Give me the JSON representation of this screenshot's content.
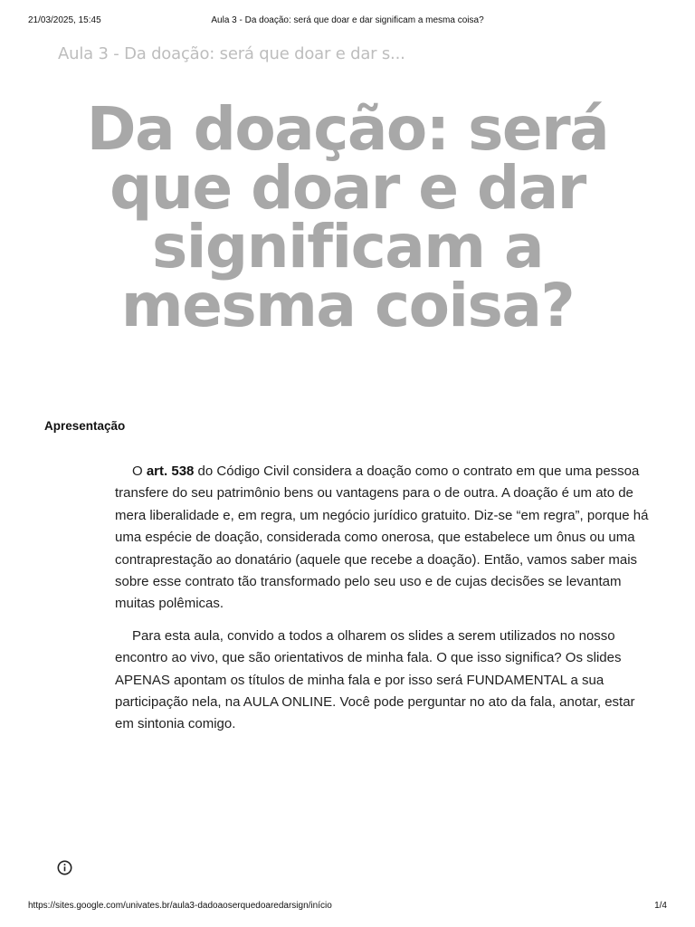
{
  "print_header": {
    "datetime": "21/03/2025, 15:45",
    "document_title": "Aula 3 - Da doação: será que doar e dar significam a mesma coisa?"
  },
  "site": {
    "title": "Aula 3 - Da doação: será que doar e dar s..."
  },
  "hero": {
    "line1": "Da doação: será",
    "line2": "que doar e dar",
    "line3": "significam a",
    "line4": "mesma coisa?"
  },
  "section": {
    "heading": "Apresentação"
  },
  "paragraph1": {
    "prefix": "O ",
    "bold": "art. 538",
    "text": " do Código Civil considera a doação como o contrato em que uma pessoa transfere do seu patrimônio bens ou vantagens para o de outra. A doação é um ato de mera liberalidade e, em regra, um negócio jurídico gratuito. Diz-se “em regra”, porque há uma espécie de doação, considerada como onerosa, que estabelece um ônus ou uma contraprestação ao donatário (aquele que recebe a doação). Então, vamos saber mais sobre esse contrato tão transformado pelo seu uso e de cujas decisões se levantam muitas polêmicas."
  },
  "paragraph2": {
    "text": "Para esta aula, convido a todos a olharem os slides a serem utilizados no nosso encontro ao vivo, que são orientativos de minha fala. O que isso significa? Os slides APENAS apontam os títulos de minha fala e por isso será FUNDAMENTAL a sua participação nela, na AULA ONLINE. Você pode perguntar no ato da fala, anotar, estar em sintonia comigo."
  },
  "icons": {
    "info": "info-icon"
  },
  "print_footer": {
    "url": "https://sites.google.com/univates.br/aula3-dadoaoserquedoaredarsign/início",
    "page": "1/4"
  }
}
